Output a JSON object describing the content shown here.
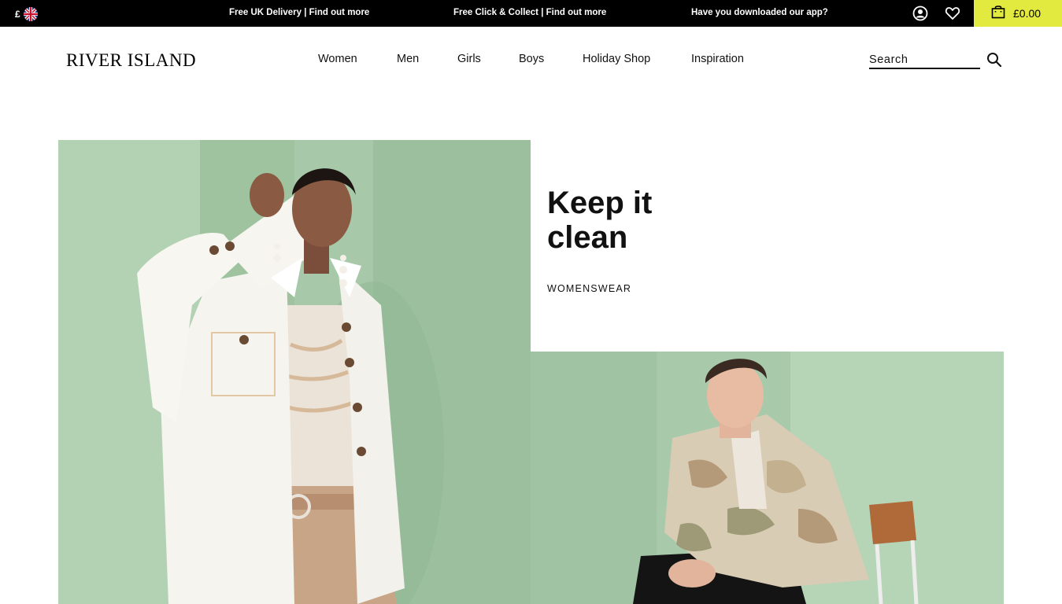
{
  "topbar": {
    "currency_symbol": "£",
    "flag_icon": "uk-flag-icon",
    "promos": [
      "Free UK Delivery | Find out more",
      "Free Click & Collect | Find out more",
      "Have you downloaded our app?"
    ],
    "account_icon": "account-icon",
    "wishlist_icon": "heart-icon",
    "bag_icon": "shopping-bag-icon",
    "bag_total": "£0.00",
    "bag_color": "#e3ea3f"
  },
  "header": {
    "logo": "RIVER ISLAND",
    "nav": [
      "Women",
      "Men",
      "Girls",
      "Boys",
      "Holiday Shop",
      "Inspiration"
    ],
    "search_placeholder": "Search",
    "search_icon": "search-icon"
  },
  "hero": {
    "title_line1": "Keep it",
    "title_line2": "clean",
    "link": "WOMENSWEAR",
    "background_color": "#a3c8a6"
  }
}
